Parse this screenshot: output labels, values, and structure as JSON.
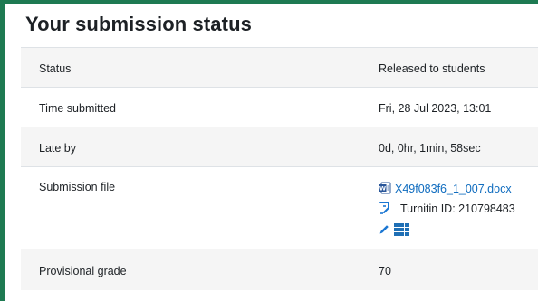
{
  "section": {
    "title": "Your submission status"
  },
  "rows": [
    {
      "label": "Status",
      "value": "Released to students"
    },
    {
      "label": "Time submitted",
      "value": "Fri, 28 Jul 2023, 13:01"
    },
    {
      "label": "Late by",
      "value": "0d, 0hr, 1min, 58sec"
    },
    {
      "label": "Submission file",
      "file": {
        "name": "X49f083f6_1_007.docx",
        "icon": "word-document-icon"
      },
      "turnitin": {
        "text": "Turnitin ID: 210798483",
        "icon": "turnitin-icon"
      },
      "actions": {
        "edit_icon": "pencil-icon",
        "grademark_icon": "grid-icon"
      }
    },
    {
      "label": "Provisional grade",
      "value": "70"
    }
  ],
  "colors": {
    "frame_border": "#1e7a52",
    "link": "#0f6cbf",
    "row_shaded": "#f5f5f5",
    "icon_blue": "#1a76d2",
    "word_blue": "#2b579a"
  }
}
